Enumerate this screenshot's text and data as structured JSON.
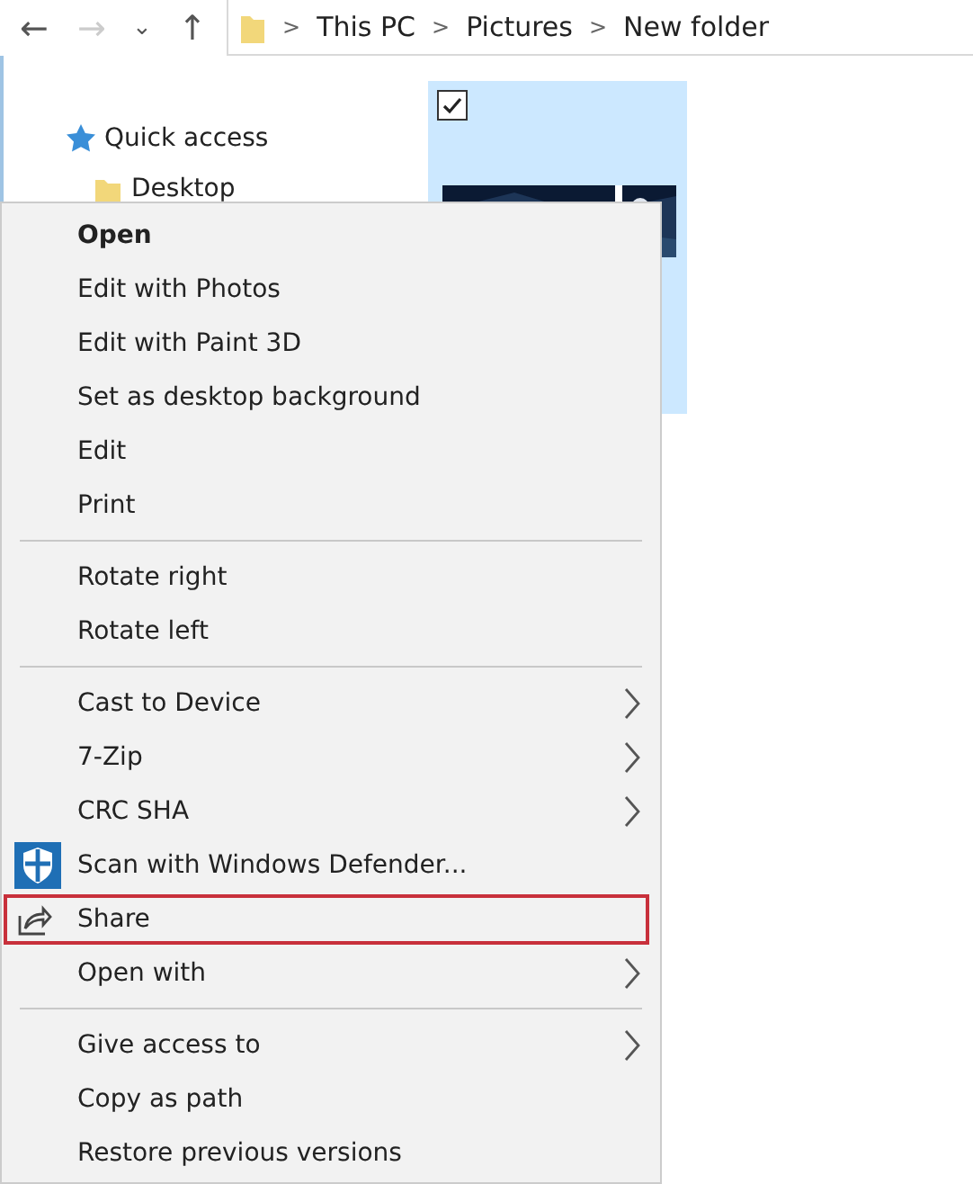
{
  "toolbar": {
    "back": "←",
    "forward": "→",
    "recent": "⌄",
    "up": "↑",
    "breadcrumb": [
      {
        "label": "This PC"
      },
      {
        "label": "Pictures"
      },
      {
        "label": "New folder"
      }
    ],
    "separator": ">"
  },
  "navigation_pane": {
    "items": [
      {
        "label": "Quick access",
        "kind": "star"
      },
      {
        "label": "Desktop",
        "kind": "folder"
      }
    ]
  },
  "file_tile": {
    "checked": true,
    "kind": "picture"
  },
  "context_menu": {
    "items": [
      {
        "kind": "item",
        "label": "Open",
        "default": true,
        "submenu": false,
        "highlighted": false
      },
      {
        "kind": "item",
        "label": "Edit with Photos",
        "default": false,
        "submenu": false,
        "highlighted": false
      },
      {
        "kind": "item",
        "label": "Edit with Paint 3D",
        "default": false,
        "submenu": false,
        "highlighted": false
      },
      {
        "kind": "item",
        "label": "Set as desktop background",
        "default": false,
        "submenu": false,
        "highlighted": false
      },
      {
        "kind": "item",
        "label": "Edit",
        "default": false,
        "submenu": false,
        "highlighted": false
      },
      {
        "kind": "item",
        "label": "Print",
        "default": false,
        "submenu": false,
        "highlighted": false
      },
      {
        "kind": "separator"
      },
      {
        "kind": "item",
        "label": "Rotate right",
        "default": false,
        "submenu": false,
        "highlighted": false
      },
      {
        "kind": "item",
        "label": "Rotate left",
        "default": false,
        "submenu": false,
        "highlighted": false
      },
      {
        "kind": "separator"
      },
      {
        "kind": "item",
        "label": "Cast to Device",
        "default": false,
        "submenu": true,
        "highlighted": false
      },
      {
        "kind": "item",
        "label": "7-Zip",
        "default": false,
        "submenu": true,
        "highlighted": false
      },
      {
        "kind": "item",
        "label": "CRC SHA",
        "default": false,
        "submenu": true,
        "highlighted": false
      },
      {
        "kind": "defender",
        "label": "Scan with Windows Defender...",
        "default": false,
        "submenu": false,
        "highlighted": false
      },
      {
        "kind": "share",
        "label": "Share",
        "default": false,
        "submenu": false,
        "highlighted": true
      },
      {
        "kind": "item",
        "label": "Open with",
        "default": false,
        "submenu": true,
        "highlighted": false
      },
      {
        "kind": "separator"
      },
      {
        "kind": "item",
        "label": "Give access to",
        "default": false,
        "submenu": true,
        "highlighted": false
      },
      {
        "kind": "item",
        "label": "Copy as path",
        "default": false,
        "submenu": false,
        "highlighted": false
      },
      {
        "kind": "item",
        "label": "Restore previous versions",
        "default": false,
        "submenu": false,
        "highlighted": false
      }
    ]
  }
}
